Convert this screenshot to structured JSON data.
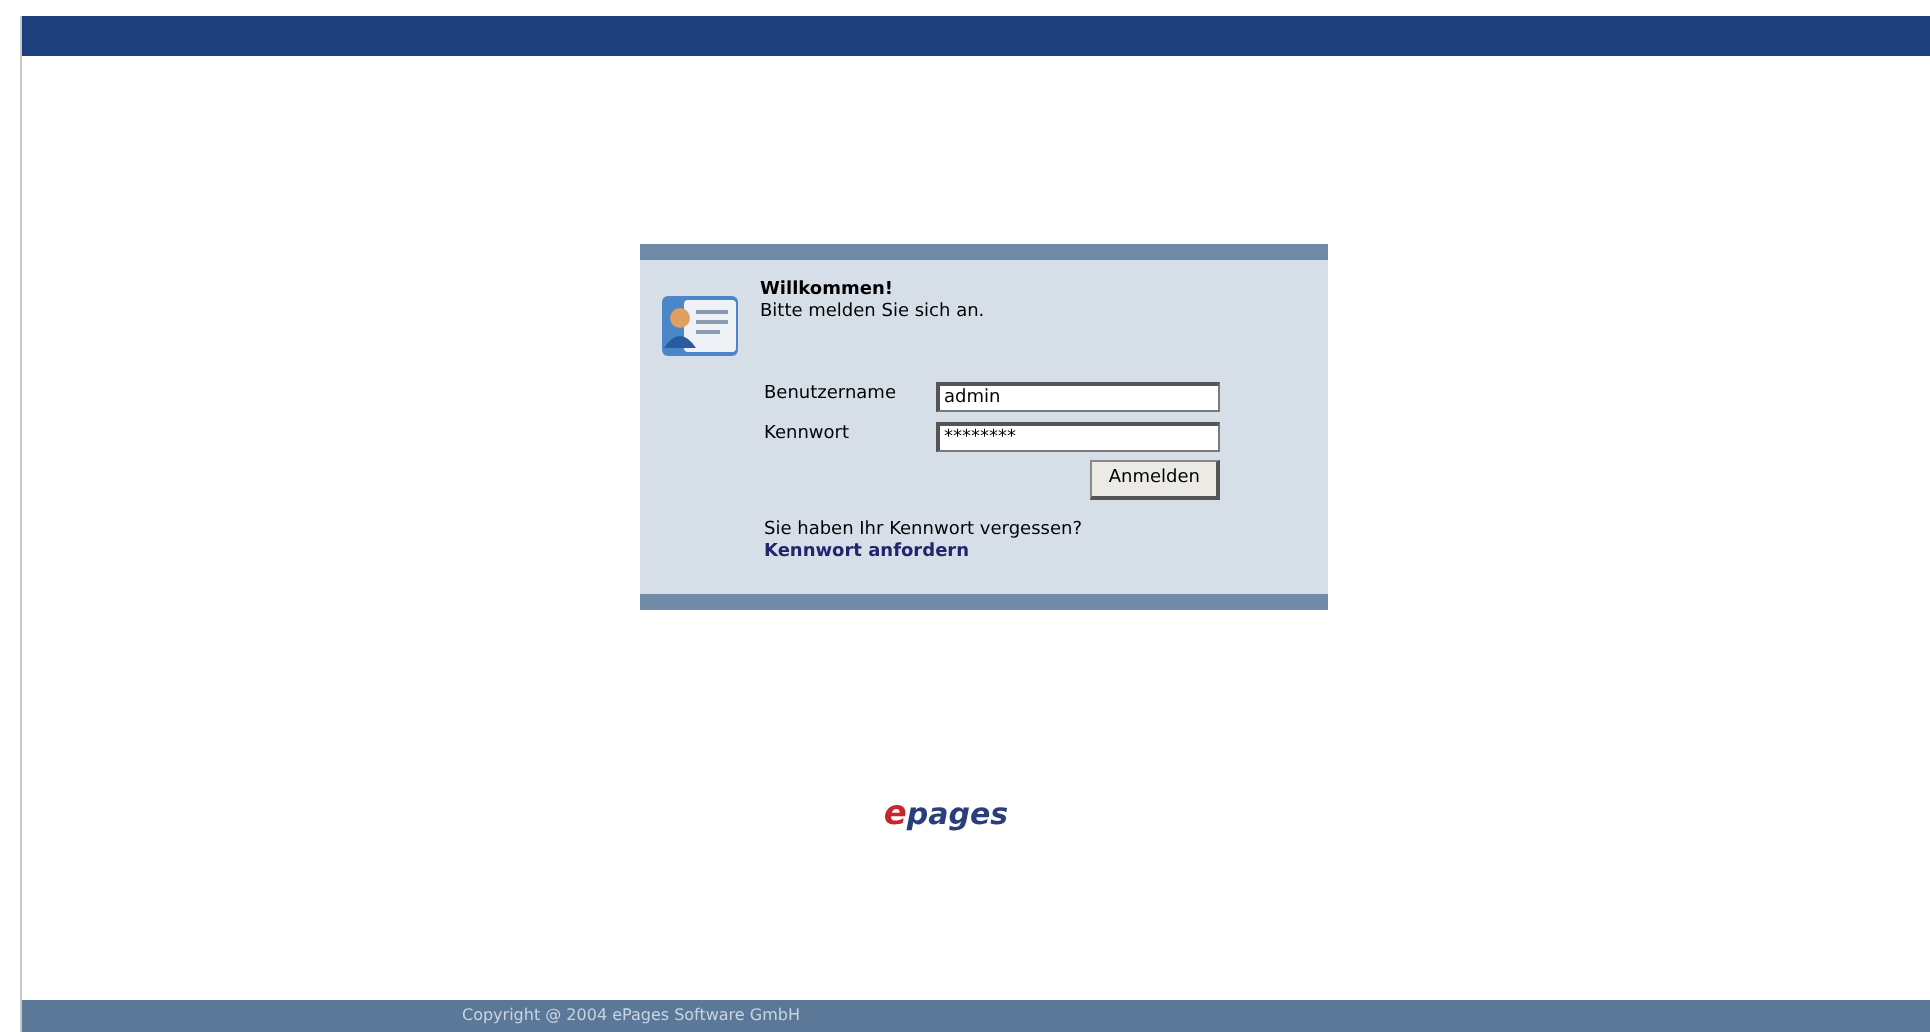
{
  "login": {
    "title": "Willkommen!",
    "subtitle": "Bitte melden Sie sich an.",
    "fields": [
      {
        "label": "Benutzername",
        "value": "admin"
      },
      {
        "label": "Kennwort",
        "value": "********"
      }
    ],
    "submit": "Anmelden",
    "forgot_text": "Sie haben Ihr Kennwort vergessen?",
    "forgot_link": "Kennwort anfordern"
  },
  "logo": {
    "accent": "e",
    "rest": "pages"
  },
  "footer": "Copyright @ 2004 ePages Software GmbH"
}
